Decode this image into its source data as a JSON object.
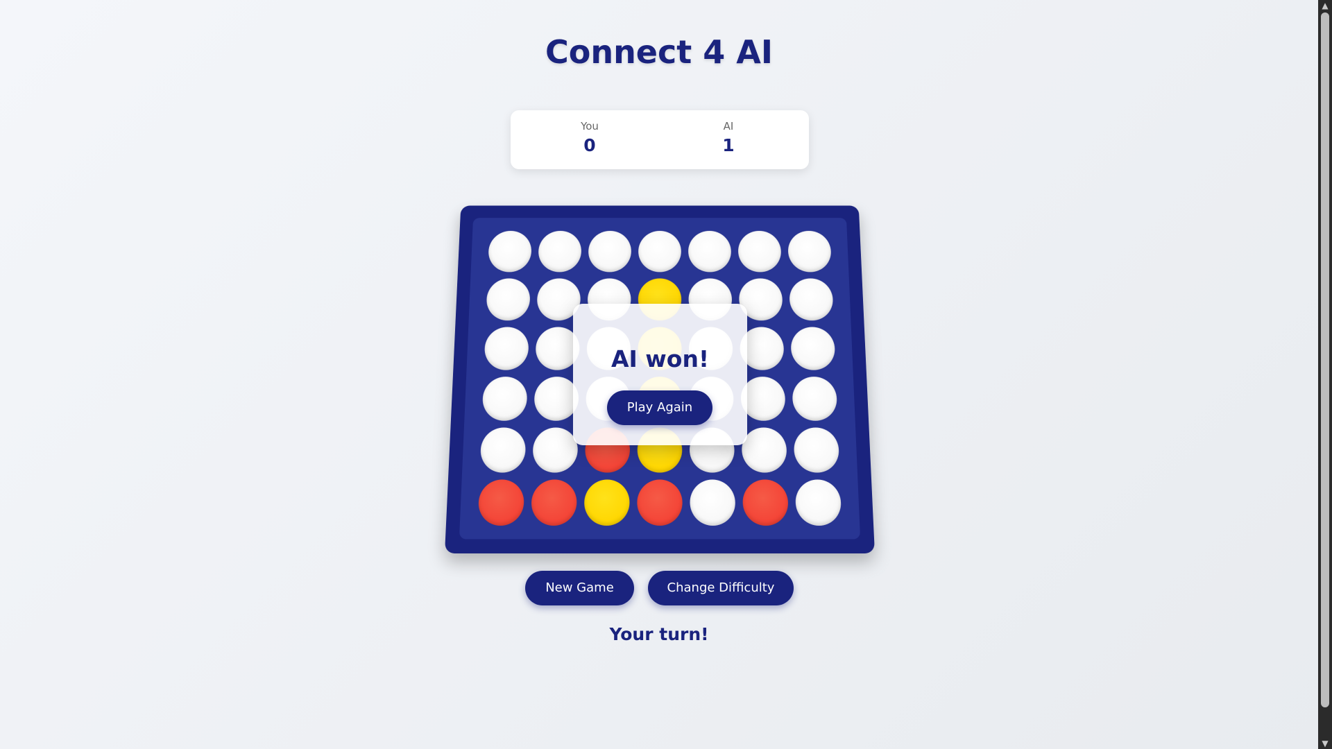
{
  "title": "Connect 4 AI",
  "score": {
    "you_label": "You",
    "you_value": "0",
    "ai_label": "AI",
    "ai_value": "1"
  },
  "board": {
    "rows": [
      [
        "empty",
        "empty",
        "empty",
        "empty",
        "empty",
        "empty",
        "empty"
      ],
      [
        "empty",
        "empty",
        "empty",
        "yellow",
        "empty",
        "empty",
        "empty"
      ],
      [
        "empty",
        "empty",
        "empty",
        "yellow",
        "empty",
        "empty",
        "empty"
      ],
      [
        "empty",
        "empty",
        "empty",
        "yellow",
        "empty",
        "empty",
        "empty"
      ],
      [
        "empty",
        "empty",
        "red",
        "yellow",
        "empty",
        "empty",
        "empty"
      ],
      [
        "red",
        "red",
        "yellow",
        "red",
        "empty",
        "red",
        "empty"
      ]
    ],
    "colors": {
      "frame": "#1a237e",
      "inner": "#283593",
      "red": "#f44336",
      "yellow": "#ffd600",
      "empty": "#ffffff"
    }
  },
  "modal": {
    "title": "AI won!",
    "button_label": "Play Again"
  },
  "controls": {
    "new_game_label": "New Game",
    "change_difficulty_label": "Change Difficulty"
  },
  "status": "Your turn!",
  "scrollbar": {
    "up_icon": "▲",
    "down_icon": "▼"
  }
}
